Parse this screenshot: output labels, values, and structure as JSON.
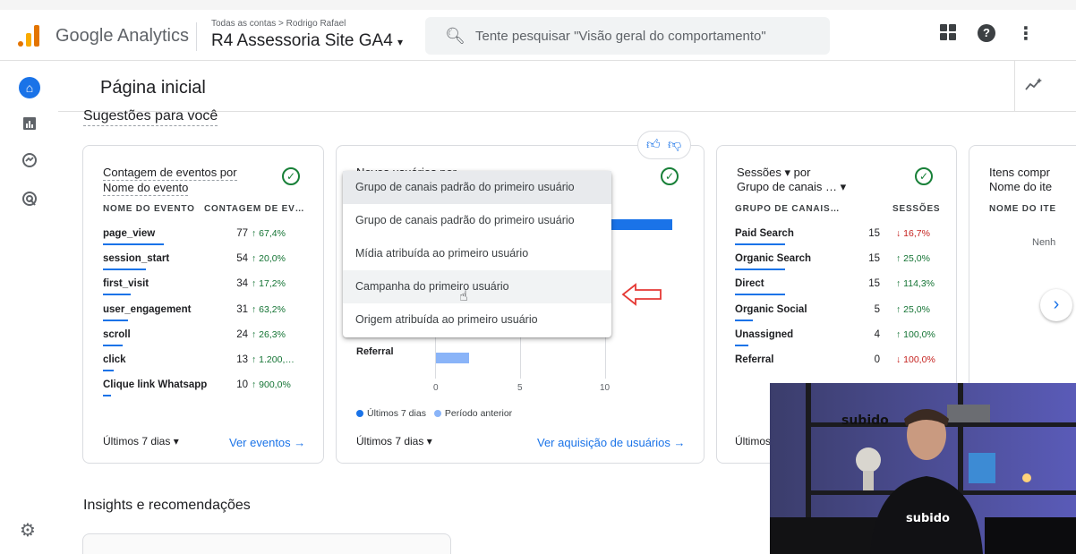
{
  "topbar": {
    "product": "Google Analytics",
    "breadcrumb": "Todas as contas > Rodrigo Rafael",
    "property": "R4 Assessoria Site GA4",
    "search_placeholder": "Tente pesquisar \"Visão geral do comportamento\""
  },
  "page": {
    "title": "Página inicial",
    "suggestions_title": "Sugestões para você",
    "insights_title": "Insights e recomendações"
  },
  "card_events": {
    "title_line1": "Contagem de eventos por",
    "title_line2": "Nome do evento",
    "col1": "NOME DO EVENTO",
    "col2": "CONTAGEM DE EV…",
    "rows": [
      {
        "name": "page_view",
        "value": "77",
        "change": "↑ 67,4%",
        "bar": 0.62
      },
      {
        "name": "session_start",
        "value": "54",
        "change": "↑ 20,0%",
        "bar": 0.44
      },
      {
        "name": "first_visit",
        "value": "34",
        "change": "↑ 17,2%",
        "bar": 0.28
      },
      {
        "name": "user_engagement",
        "value": "31",
        "change": "↑ 63,2%",
        "bar": 0.25
      },
      {
        "name": "scroll",
        "value": "24",
        "change": "↑ 26,3%",
        "bar": 0.2
      },
      {
        "name": "click",
        "value": "13",
        "change": "↑ 1.200,…",
        "bar": 0.11
      },
      {
        "name": "Clique link Whatsapp",
        "value": "10",
        "change": "↑ 900,0%",
        "bar": 0.08
      }
    ],
    "footer_range": "Últimos 7 dias",
    "footer_link": "Ver eventos"
  },
  "card_users": {
    "title": "Novos usuários por",
    "referral_label": "Referral",
    "axis_ticks": [
      "0",
      "5",
      "10"
    ],
    "legend_current": "Últimos 7 dias",
    "legend_previous": "Período anterior",
    "footer_range": "Últimos 7 dias",
    "footer_link": "Ver aquisição de usuários"
  },
  "dropdown": {
    "options": [
      "Grupo de canais padrão do primeiro usuário",
      "Grupo de canais padrão do primeiro usuário",
      "Mídia atribuída ao primeiro usuário",
      "Campanha do primeiro usuário",
      "Origem atribuída ao primeiro usuário"
    ]
  },
  "card_sessions": {
    "title_line1": "Sessões ▾ por",
    "title_line2": "Grupo de canais … ▾",
    "col1": "GRUPO DE CANAIS…",
    "col2": "SESSÕES",
    "rows": [
      {
        "name": "Paid Search",
        "value": "15",
        "change": "↓ 16,7%",
        "dir": "down",
        "bar": 0.4
      },
      {
        "name": "Organic Search",
        "value": "15",
        "change": "↑ 25,0%",
        "dir": "up",
        "bar": 0.4
      },
      {
        "name": "Direct",
        "value": "15",
        "change": "↑ 114,3%",
        "dir": "up",
        "bar": 0.4
      },
      {
        "name": "Organic Social",
        "value": "5",
        "change": "↑ 25,0%",
        "dir": "up",
        "bar": 0.14
      },
      {
        "name": "Unassigned",
        "value": "4",
        "change": "↑ 100,0%",
        "dir": "up",
        "bar": 0.11
      },
      {
        "name": "Referral",
        "value": "0",
        "change": "↓ 100,0%",
        "dir": "down",
        "bar": 0
      }
    ],
    "footer_range": "Últimos"
  },
  "card_items": {
    "title_line1": "Itens compr",
    "title_line2": "Nome do ite",
    "col1": "NOME DO ITE",
    "empty": "Nenh"
  },
  "webcam": {
    "sign": "subido",
    "shirt": "subido"
  },
  "colors": {
    "accent": "#1a73e8",
    "positive": "#137333",
    "negative": "#c5221f",
    "annotation": "#e53935"
  }
}
